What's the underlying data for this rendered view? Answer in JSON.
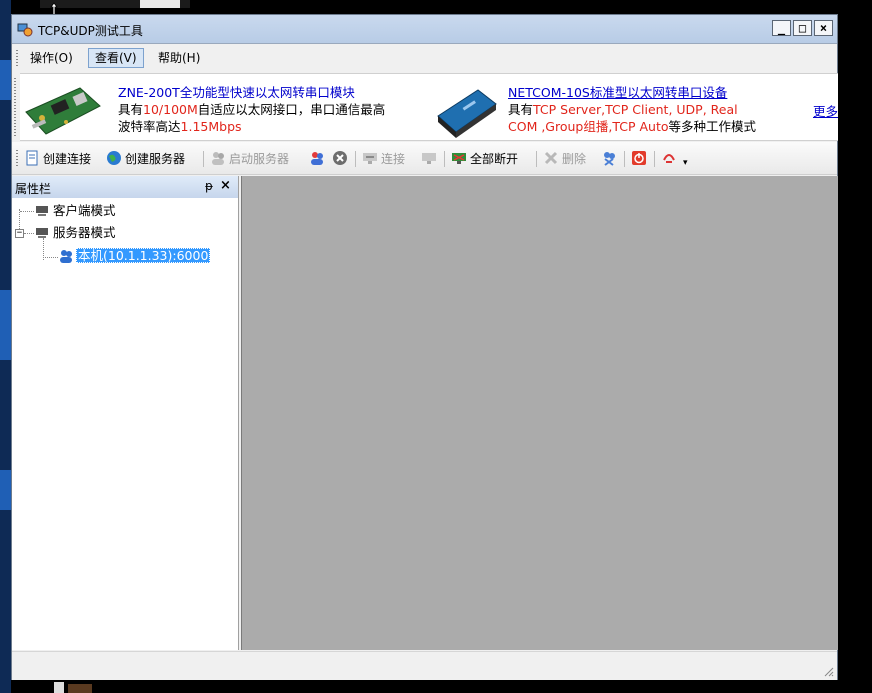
{
  "window": {
    "title": "TCP&UDP测试工具",
    "controls": [
      "_",
      "□",
      "×"
    ]
  },
  "menu": [
    {
      "label": "操作(O)",
      "active": false
    },
    {
      "label": "查看(V)",
      "active": true
    },
    {
      "label": "帮助(H)",
      "active": false
    }
  ],
  "ads": [
    {
      "title": "ZNE-200T全功能型快速以太网转串口模块",
      "line2_a": "具有",
      "line2_red": "10/100M",
      "line2_b": "自适应以太网接口，串口通信最高",
      "line3_a": "波特率高达",
      "line3_red": "1.15Mbps"
    },
    {
      "title": "NETCOM-10S标准型以太网转串口设备",
      "line2_a": "具有",
      "line2_red": "TCP Server,TCP Client, UDP, Real",
      "line3_red": "COM ,Group组播,TCP Auto",
      "line3_b": "等多种工作模式"
    }
  ],
  "more_link": "更多",
  "toolbar": {
    "create_connection": "创建连接",
    "create_server": "创建服务器",
    "start_server": "启动服务器",
    "connect": "连接",
    "disconnect_all": "全部断开",
    "delete": "删除"
  },
  "panel": {
    "title": "属性栏",
    "pin": "ᵽ",
    "close": "×"
  },
  "tree": {
    "client_mode": "客户端模式",
    "server_mode": "服务器模式",
    "server_item": "本机(10.1.1.33):6000"
  },
  "colors": {
    "accent_red": "#e1251b",
    "link_blue": "#0000cc",
    "selection": "#3399ff",
    "workspace": "#ababab"
  }
}
